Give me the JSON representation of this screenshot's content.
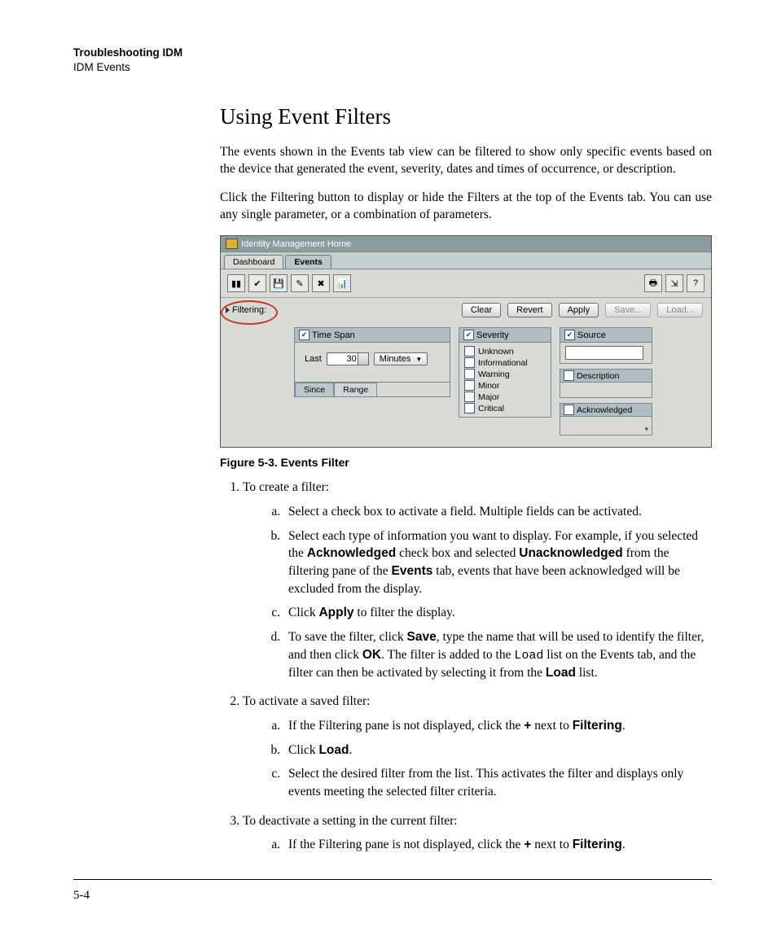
{
  "header": {
    "section": "Troubleshooting IDM",
    "subsection": "IDM Events"
  },
  "title": "Using Event Filters",
  "para1": "The events shown in the Events tab view can be filtered to show only specific events based on the device that generated the event, severity, dates and times of occurrence, or description.",
  "para2": "Click the Filtering button to display or hide the Filters at the top of the Events tab. You can use any single parameter, or a combination of parameters.",
  "figure": {
    "windowTitle": "Identity Management Home",
    "tabs": {
      "dashboard": "Dashboard",
      "events": "Events"
    },
    "filterLabel": "Filtering:",
    "buttons": {
      "clear": "Clear",
      "revert": "Revert",
      "apply": "Apply",
      "save": "Save...",
      "load": "Load..."
    },
    "timespan": {
      "title": "Time Span",
      "lastLabel": "Last",
      "value": "30",
      "unit": "Minutes",
      "tabSince": "Since",
      "tabRange": "Range"
    },
    "severity": {
      "title": "Severity",
      "options": [
        "Unknown",
        "Informational",
        "Warning",
        "Minor",
        "Major",
        "Critical"
      ]
    },
    "source": {
      "title": "Source"
    },
    "description": {
      "title": "Description"
    },
    "acknowledged": {
      "title": "Acknowledged"
    }
  },
  "caption": "Figure 5-3. Events Filter",
  "steps": {
    "s1": "To create a filter:",
    "s1a": "Select a check box to activate a field. Multiple fields can be activated.",
    "s1b_1": "Select each type of information you want to display. For example, if you selected the ",
    "s1b_ack": "Acknowledged",
    "s1b_2": " check box and selected ",
    "s1b_unack": "Unacknowledged",
    "s1b_3": " from the filtering pane of the ",
    "s1b_events": "Events",
    "s1b_4": " tab, events that have been acknowledged will be excluded from the display.",
    "s1c_1": "Click ",
    "s1c_apply": "Apply",
    "s1c_2": " to filter the display.",
    "s1d_1": "To save the filter, click ",
    "s1d_save": "Save",
    "s1d_2": ", type the name that will be used to identify the filter, and then click ",
    "s1d_ok": "OK",
    "s1d_3": ". The filter is added to the ",
    "s1d_load1": "Load",
    "s1d_4": " list on the Events tab, and the filter can then be activated by selecting it from the ",
    "s1d_load2": "Load",
    "s1d_5": " list.",
    "s2": "To activate a saved filter:",
    "s2a_1": "If the Filtering pane is not displayed, click the ",
    "s2a_plus": "+",
    "s2a_2": " next to ",
    "s2a_filt": "Filtering",
    "s2a_3": ".",
    "s2b_1": "Click ",
    "s2b_load": "Load",
    "s2b_2": ".",
    "s2c": "Select the desired filter from the list. This activates the filter and displays only events meeting the selected filter criteria.",
    "s3": "To deactivate a setting in the current filter:",
    "s3a_1": "If the Filtering pane is not displayed, click the ",
    "s3a_plus": "+",
    "s3a_2": " next to ",
    "s3a_filt": "Filtering",
    "s3a_3": "."
  },
  "pageNumber": "5-4"
}
